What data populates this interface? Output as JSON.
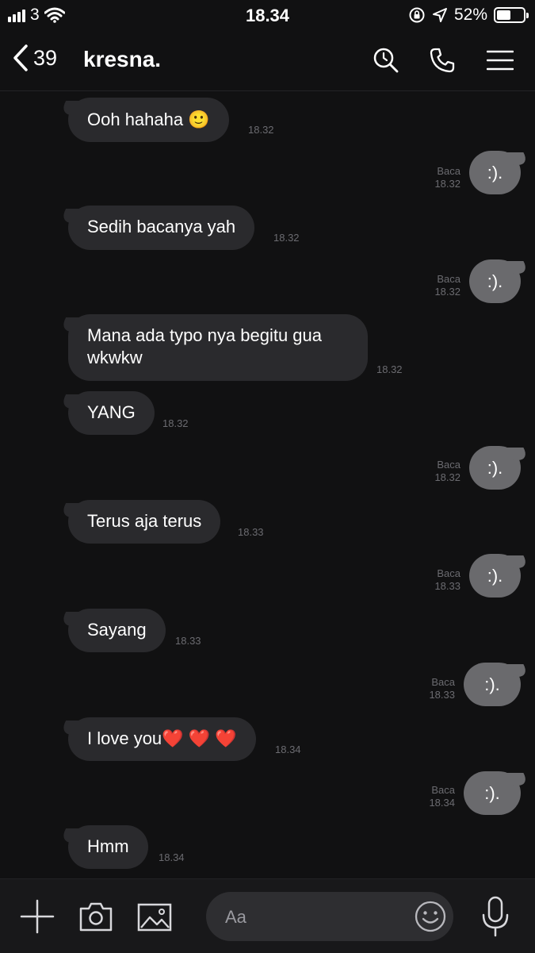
{
  "status_bar": {
    "carrier": "3",
    "time": "18.34",
    "battery_percent": "52%",
    "battery_level": 0.52,
    "icons": [
      "signal-bars-icon",
      "wifi-icon",
      "rotation-lock-icon",
      "location-arrow-icon",
      "battery-icon"
    ]
  },
  "header": {
    "back_count": "39",
    "title": "kresna.",
    "icons": [
      "chevron-left-icon",
      "search-icon",
      "phone-icon",
      "menu-icon"
    ]
  },
  "messages": [
    {
      "dir": "in",
      "text": "Ooh hahaha 🙂",
      "time": "18.32"
    },
    {
      "dir": "out",
      "text": ":).",
      "status": "Baca",
      "time": "18.32"
    },
    {
      "dir": "in",
      "text": "Sedih bacanya yah",
      "time": "18.32"
    },
    {
      "dir": "out",
      "text": ":).",
      "status": "Baca",
      "time": "18.32"
    },
    {
      "dir": "in",
      "text": "Mana ada typo nya begitu gua wkwkw",
      "time": "18.32"
    },
    {
      "dir": "in",
      "text": "YANG",
      "time": "18.32"
    },
    {
      "dir": "out",
      "text": ":).",
      "status": "Baca",
      "time": "18.32"
    },
    {
      "dir": "in",
      "text": "Terus aja terus",
      "time": "18.33"
    },
    {
      "dir": "out",
      "text": ":).",
      "status": "Baca",
      "time": "18.33"
    },
    {
      "dir": "in",
      "text": "Sayang",
      "time": "18.33"
    },
    {
      "dir": "out",
      "text": ":).",
      "status": "Baca",
      "time": "18.33"
    },
    {
      "dir": "in",
      "text": "I love you❤️ ❤️ ❤️",
      "time": "18.34"
    },
    {
      "dir": "out",
      "text": ":).",
      "status": "Baca",
      "time": "18.34"
    },
    {
      "dir": "in",
      "text": "Hmm",
      "time": "18.34"
    }
  ],
  "composer": {
    "placeholder": "Aa",
    "icons": [
      "plus-icon",
      "camera-icon",
      "image-icon",
      "emoji-icon",
      "microphone-icon"
    ]
  },
  "colors": {
    "background": "#111112",
    "incoming_bubble": "#2a2a2d",
    "outgoing_bubble": "#6a6a6d",
    "timestamp": "#6b6b70"
  }
}
